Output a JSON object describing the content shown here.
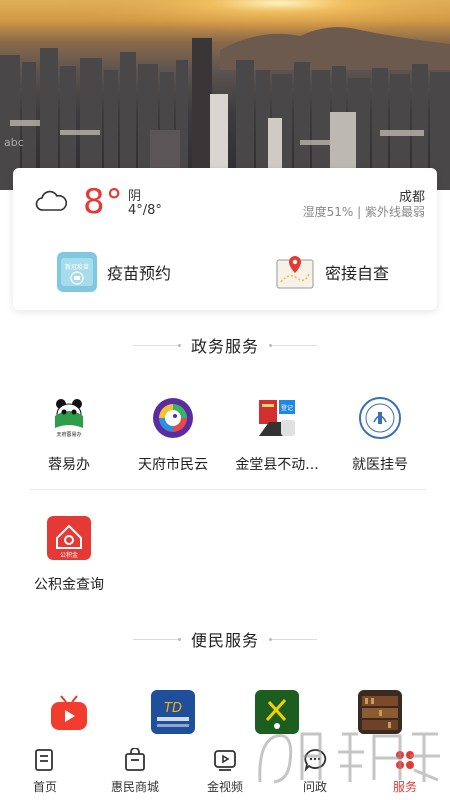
{
  "weather": {
    "temperature": "8°",
    "condition": "阴",
    "range": "4°/8°",
    "city": "成都",
    "humidity": "湿度51% | 紫外线最弱",
    "icon": "cloud-icon"
  },
  "quick_actions": [
    {
      "label": "疫苗预约",
      "icon": "vaccine-icon"
    },
    {
      "label": "密接自查",
      "icon": "map-pin-icon"
    }
  ],
  "hero": {
    "watermark": "abc"
  },
  "gov_section": {
    "title": "政务服务",
    "items": [
      {
        "label": "蓉易办",
        "icon": "panda-icon"
      },
      {
        "label": "天府市民云",
        "icon": "citizen-cloud-icon"
      },
      {
        "label": "金堂县不动...",
        "icon": "property-registry-icon"
      },
      {
        "label": "就医挂号",
        "icon": "hospital-seal-icon"
      },
      {
        "label": "公积金查询",
        "icon": "housing-fund-icon"
      }
    ]
  },
  "civic_section": {
    "title": "便民服务",
    "items": [
      {
        "icon": "video-tv-icon"
      },
      {
        "icon": "custom-service-icon"
      },
      {
        "icon": "green-service-icon"
      },
      {
        "icon": "library-icon"
      }
    ]
  },
  "tabs": [
    {
      "label": "首页",
      "icon": "home-icon"
    },
    {
      "label": "惠民商城",
      "icon": "shop-bag-icon"
    },
    {
      "label": "金视频",
      "icon": "video-icon"
    },
    {
      "label": "问政",
      "icon": "chat-icon"
    },
    {
      "label": "服务",
      "icon": "service-icon",
      "active": true
    }
  ],
  "colors": {
    "accent": "#e53935",
    "text": "#222222",
    "muted": "#888888"
  }
}
